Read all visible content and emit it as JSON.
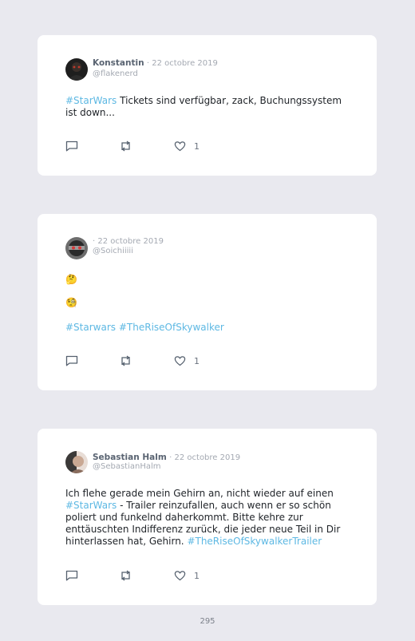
{
  "tweets": [
    {
      "name": "Konstantin",
      "date": "· 22 octobre 2019",
      "handle": "@flakenerd",
      "text_parts": [
        "#StarWars",
        " Tickets sind verfügbar, zack, Buchungssystem ist down..."
      ],
      "likes": "1"
    },
    {
      "name": "",
      "date": "· 22 octobre 2019",
      "handle": "@Soichiiiii",
      "emoji_1": "🤔",
      "emoji_2": "🧐",
      "hashtags": [
        "#Starwars",
        "#TheRiseOfSkywalker"
      ],
      "likes": "1"
    },
    {
      "name": "Sebastian Halm",
      "date": "· 22 octobre 2019",
      "handle": "@SebastianHalm",
      "text_parts": [
        "Ich flehe gerade mein Gehirn an, nicht wieder auf einen ",
        "#StarWars",
        " - Trailer reinzufallen, auch wenn er so schön poliert und funkelnd daherkommt. Bitte kehre zur enttäuschten Indifferenz zurück, die jeder neue Teil in Dir hinterlassen hat, Gehirn. ",
        "#TheRiseOfSkywalkerTrailer"
      ],
      "likes": "1"
    }
  ],
  "icons": {
    "reply": "reply-icon",
    "retweet": "retweet-icon",
    "like": "heart-icon"
  },
  "colors": {
    "background": "#e9e9ef",
    "card": "#ffffff",
    "hashtag": "#5db8e3",
    "name": "#5a6472",
    "meta": "#a4a9b2"
  },
  "page_number": "295"
}
